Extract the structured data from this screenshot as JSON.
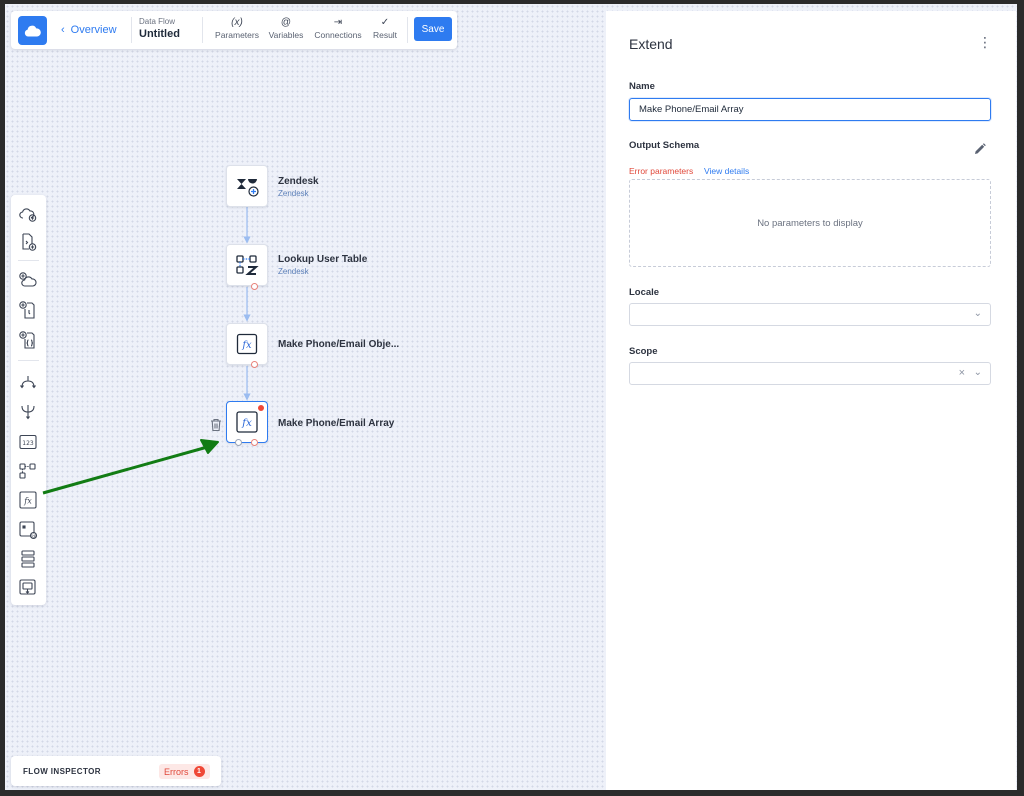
{
  "toolbar": {
    "back_label": "Overview",
    "flow_type": "Data Flow",
    "flow_name": "Untitled",
    "items": [
      {
        "icon": "(x)",
        "label": "Parameters"
      },
      {
        "icon": "@",
        "label": "Variables"
      },
      {
        "icon": "⇥",
        "label": "Connections"
      },
      {
        "icon": "✓",
        "label": "Result"
      }
    ],
    "save_label": "Save"
  },
  "nodes": [
    {
      "title": "Zendesk",
      "subtitle": "Zendesk",
      "icon": "zendesk-add-icon"
    },
    {
      "title": "Lookup User Table",
      "subtitle": "Zendesk",
      "icon": "lookup-table-icon"
    },
    {
      "title": "Make Phone/Email Obje...",
      "subtitle": "",
      "icon": "function-icon"
    },
    {
      "title": "Make Phone/Email Array",
      "subtitle": "",
      "icon": "function-icon"
    }
  ],
  "inspector": {
    "label": "FLOW INSPECTOR",
    "errors_label": "Errors",
    "errors_count": "1"
  },
  "panel": {
    "title": "Extend",
    "name_label": "Name",
    "name_value": "Make Phone/Email Array",
    "output_schema_label": "Output Schema",
    "error_parameters": "Error parameters",
    "view_details": "View details",
    "empty_schema": "No parameters to display",
    "locale_label": "Locale",
    "locale_value": "",
    "scope_label": "Scope",
    "scope_value": ""
  },
  "colors": {
    "accent": "#2e7bf0",
    "error": "#ef4836",
    "annotation_arrow": "#127c14"
  }
}
